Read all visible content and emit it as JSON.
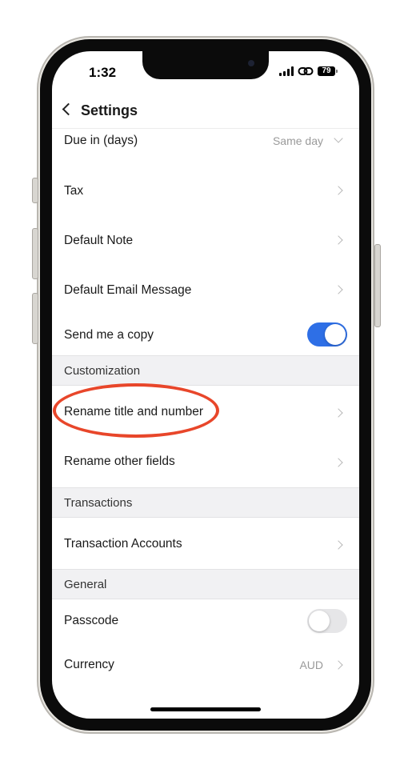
{
  "status_bar": {
    "time": "1:32",
    "battery": "79"
  },
  "nav": {
    "title": "Settings"
  },
  "rows": {
    "due": {
      "label": "Due in (days)",
      "value": "Same day"
    },
    "tax": {
      "label": "Tax"
    },
    "default_note": {
      "label": "Default Note"
    },
    "default_email": {
      "label": "Default Email Message"
    },
    "send_copy": {
      "label": "Send me a copy",
      "enabled": true
    },
    "rename_title": {
      "label": "Rename title and number"
    },
    "rename_other": {
      "label": "Rename other fields"
    },
    "transaction_accounts": {
      "label": "Transaction Accounts"
    },
    "passcode": {
      "label": "Passcode",
      "enabled": false
    },
    "currency": {
      "label": "Currency",
      "value": "AUD"
    }
  },
  "sections": {
    "customization": "Customization",
    "transactions": "Transactions",
    "general": "General"
  },
  "colors": {
    "accent": "#2e6fe6",
    "highlight": "#e8462a",
    "section_bg": "#f1f1f3"
  }
}
